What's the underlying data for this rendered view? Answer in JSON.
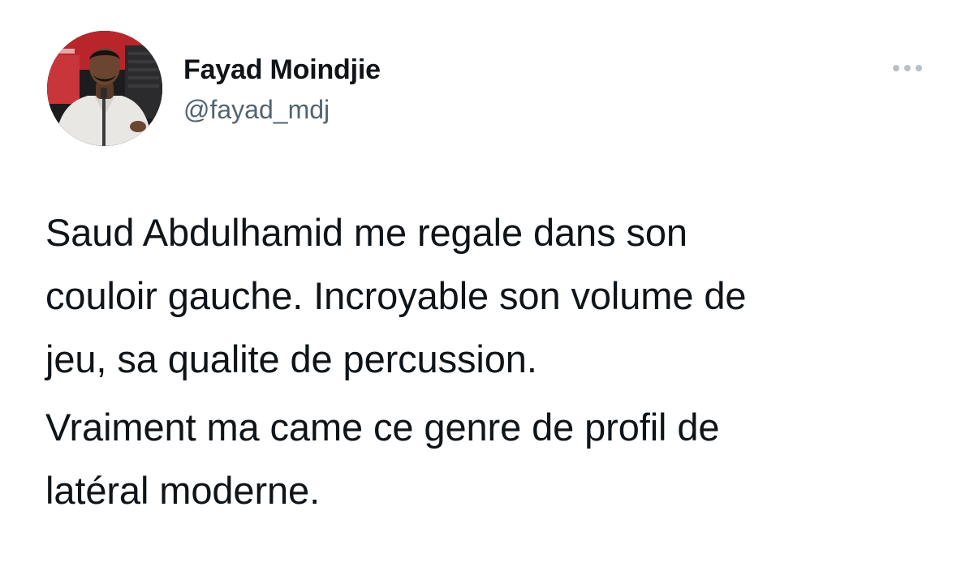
{
  "tweet": {
    "author": {
      "display_name": "Fayad Moindjie",
      "handle": "@fayad_mdj",
      "avatar_icon": "person-with-microphone"
    },
    "more_icon": "more-horizontal-icon",
    "paragraphs": [
      {
        "lines": [
          "Saud Abdulhamid me regale dans son",
          "couloir gauche. Incroyable son volume de",
          "jeu, sa qualite de percussion."
        ]
      },
      {
        "lines": [
          "Vraiment ma came ce genre de profil de",
          "latéral moderne."
        ]
      }
    ]
  },
  "colors": {
    "text_primary": "#0f1419",
    "text_secondary": "#536471",
    "background": "#ffffff"
  }
}
